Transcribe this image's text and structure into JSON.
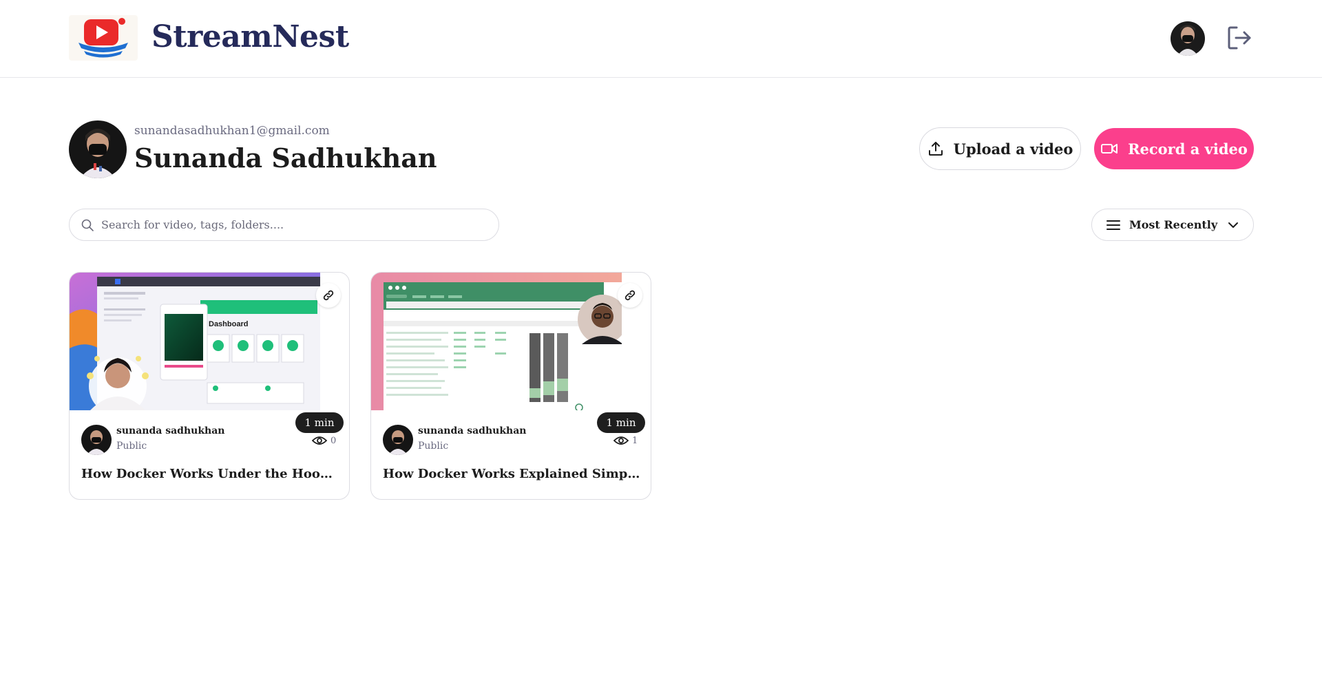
{
  "brand": {
    "name": "StreamNest",
    "accent": "#252a5a",
    "logo_icon": "play-boat-logo"
  },
  "header": {
    "avatar_icon": "user-avatar",
    "logout_icon": "logout-icon"
  },
  "profile": {
    "email": "sunandasadhukhan1@gmail.com",
    "name": "Sunanda Sadhukhan"
  },
  "actions": {
    "upload_label": "Upload a video",
    "record_label": "Record a video",
    "record_color": "#fb3f8c"
  },
  "search": {
    "placeholder": "Search for video, tags, folders...."
  },
  "sort": {
    "label": "Most Recently"
  },
  "videos": [
    {
      "duration": "1 min",
      "author": "sunanda sadhukhan",
      "visibility": "Public",
      "views": "0",
      "title": "How Docker Works Under the Hood - Just Explained",
      "thumbnail_text": "Dashboard"
    },
    {
      "duration": "1 min",
      "author": "sunanda sadhukhan",
      "visibility": "Public",
      "views": "1",
      "title": "How Docker Works Explained Simply - For Beginners"
    }
  ]
}
